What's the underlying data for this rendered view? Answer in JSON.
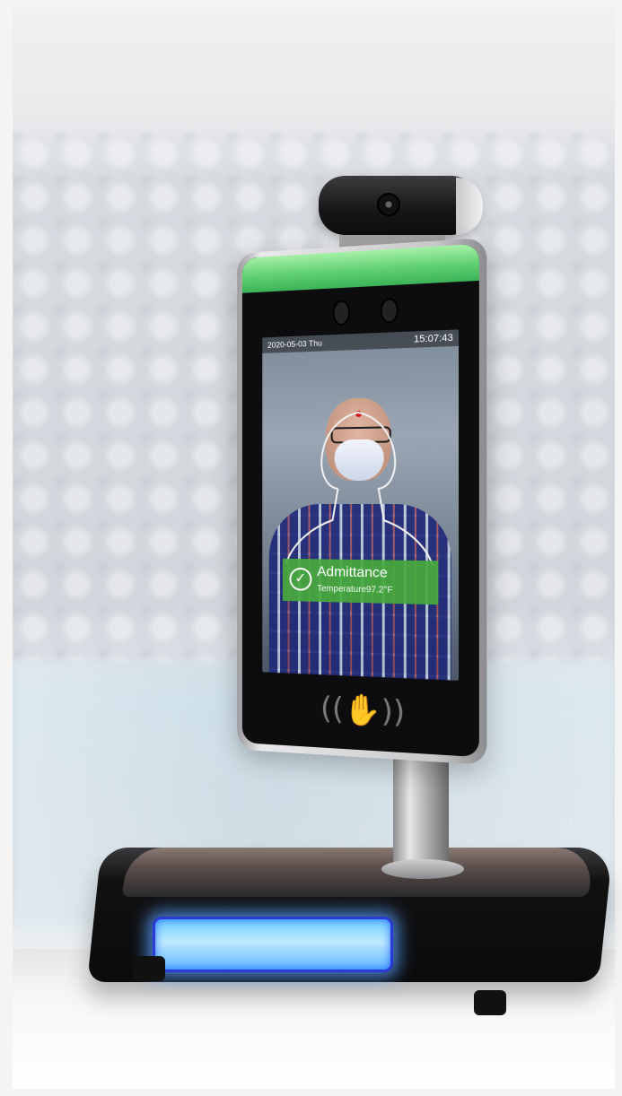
{
  "screen": {
    "date": "2020-05-03 Thu",
    "time": "15:07:43",
    "status_title": "Admittance",
    "temperature": "Temperature97.2°F"
  },
  "icons": {
    "check": "check-circle-icon",
    "nfc": "nfc-card-icon"
  },
  "colors": {
    "green_light": "#5fcf72",
    "admit_banner": "#46aa3c",
    "led_blue": "#5fb8ff"
  }
}
